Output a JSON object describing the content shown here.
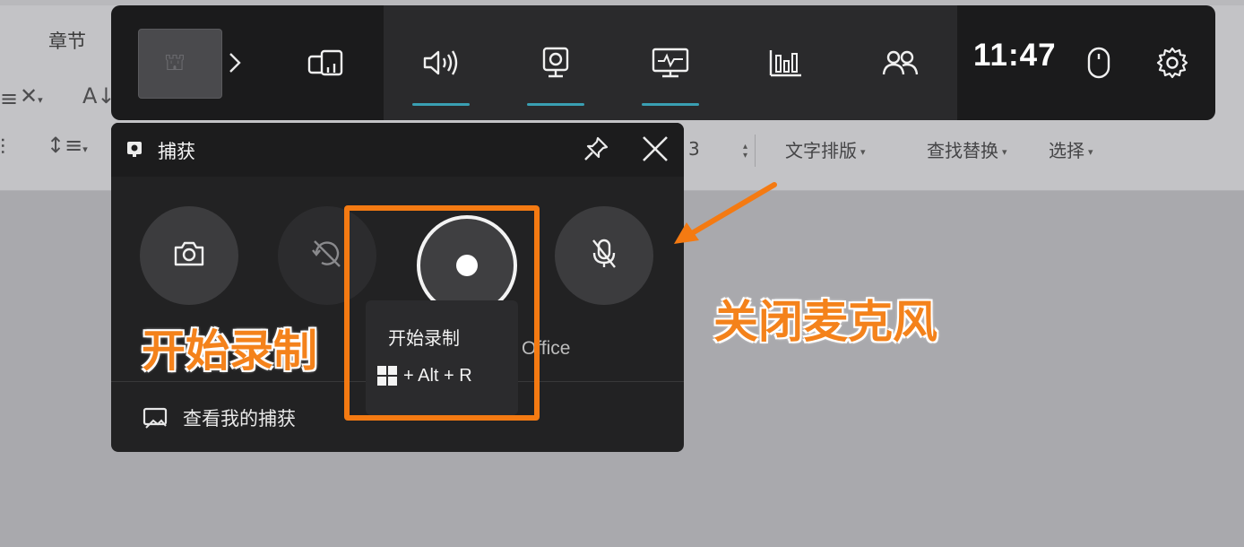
{
  "background_app": {
    "tab_label": "章节",
    "ribbon": {
      "text_layout_label": "文字排版",
      "find_replace_label": "查找替换",
      "select_label": "选择",
      "spinner_value": "3"
    }
  },
  "game_bar": {
    "widgets": [
      {
        "name": "widget-menu",
        "icon": "widget-menu-icon"
      },
      {
        "name": "audio",
        "icon": "speaker-icon",
        "active": true
      },
      {
        "name": "capture",
        "icon": "capture-camera-icon",
        "active": true
      },
      {
        "name": "performance",
        "icon": "performance-monitor-icon",
        "active": true
      },
      {
        "name": "resources",
        "icon": "bar-chart-icon"
      },
      {
        "name": "social",
        "icon": "people-icon"
      }
    ],
    "clock": "11:47",
    "accent_color": "#3a9fb3"
  },
  "capture_widget": {
    "title": "捕获",
    "mic_label_partial": "Office",
    "footer_link": "查看我的捕获",
    "tooltip": {
      "title": "开始录制",
      "shortcut": "+ Alt + R"
    }
  },
  "annotations": {
    "start_recording": "开始录制",
    "turn_off_mic": "关闭麦克风",
    "highlight_color": "#f47a12"
  }
}
